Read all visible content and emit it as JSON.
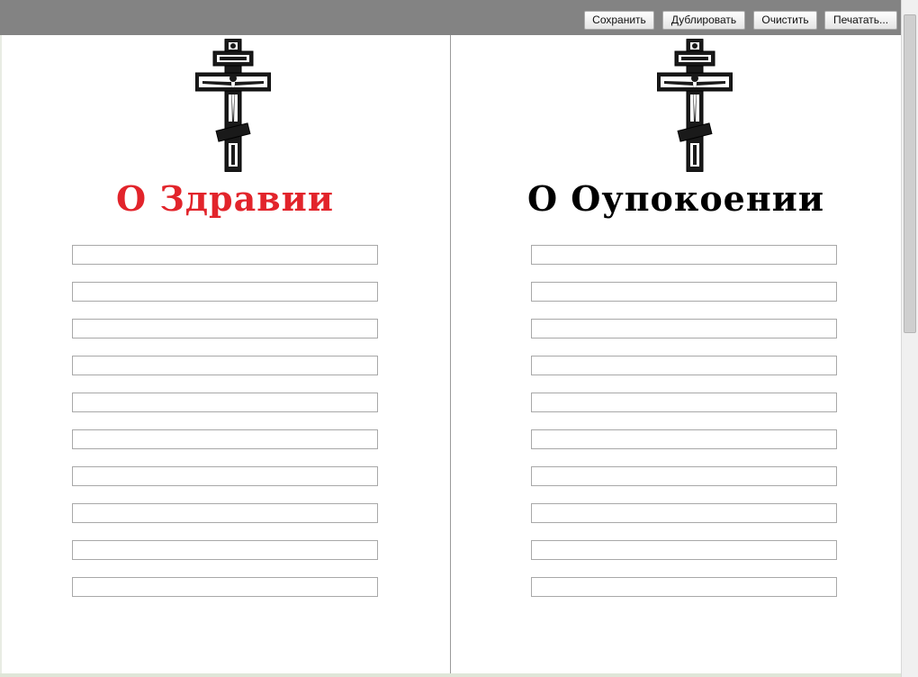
{
  "toolbar": {
    "save_label": "Сохранить",
    "duplicate_label": "Дублировать",
    "clear_label": "Очистить",
    "print_label": "Печатать..."
  },
  "left_panel": {
    "title": "О Здравии",
    "title_color": "#e2242b",
    "cross_icon": "orthodox-cross-icon",
    "names": [
      "",
      "",
      "",
      "",
      "",
      "",
      "",
      "",
      "",
      ""
    ]
  },
  "right_panel": {
    "title": "О Оупокоении",
    "title_color": "#000000",
    "cross_icon": "orthodox-cross-icon",
    "names": [
      "",
      "",
      "",
      "",
      "",
      "",
      "",
      "",
      "",
      ""
    ]
  }
}
